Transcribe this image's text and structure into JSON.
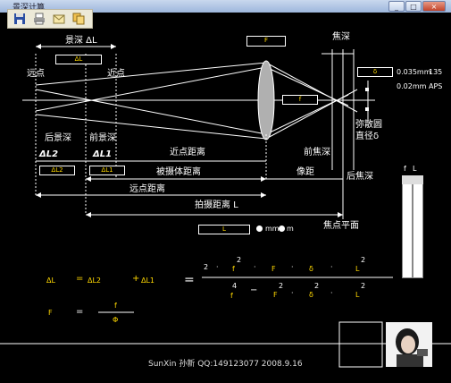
{
  "window": {
    "title": "景深计算",
    "btn_min": "_",
    "btn_max": "□",
    "btn_close": "×"
  },
  "toolbar": {
    "icons": [
      "save-icon",
      "print-icon",
      "mail-icon",
      "copy-icon"
    ]
  },
  "diagram": {
    "depth_of_field": "景深 ΔL",
    "far_point": "远点",
    "near_point": "近点",
    "focal_depth": "焦深",
    "rear_dof": "后景深",
    "front_dof": "前景深",
    "near_dist": "近点距离",
    "front_focal_depth": "前焦深",
    "rear_focal_depth": "后焦深",
    "circle_conf_line1": "弥散圆",
    "circle_conf_line2": "直径δ",
    "dl2": "ΔL2",
    "dl1": "ΔL1",
    "subject_dist": "被摄体距离",
    "image_dist": "像距",
    "far_dist": "远点距离",
    "shooting_dist": "拍摄距离 L",
    "focal_plane": "焦点平面"
  },
  "fields": {
    "dl": "ΔL",
    "F": "F",
    "f": "f",
    "delta": "δ",
    "dl2": "ΔL2",
    "dl1": "ΔL1",
    "L": "L"
  },
  "coc_options": {
    "opt1_value": "0.035mm",
    "opt1_format": "135",
    "opt2_value": "0.02mm",
    "opt2_format": "APS"
  },
  "units": {
    "mm": "mm",
    "m": "m"
  },
  "scroll_panel": {
    "label_f": "f",
    "label_l": "L"
  },
  "formulas": {
    "dl": "ΔL",
    "eq1": "=",
    "dl2": "ΔL2",
    "plus": "+",
    "dl1": "ΔL1",
    "eq2": "=",
    "two": "2",
    "dot": "·",
    "f": "f",
    "F": "F",
    "delta": "δ",
    "L": "L",
    "four": "4",
    "minus": "−",
    "F_lhs": "F",
    "eq3": "=",
    "f_num": "f",
    "phi": "Φ"
  },
  "footer": {
    "credit": "SunXin 孙新  QQ:149123077  2008.9.16"
  }
}
